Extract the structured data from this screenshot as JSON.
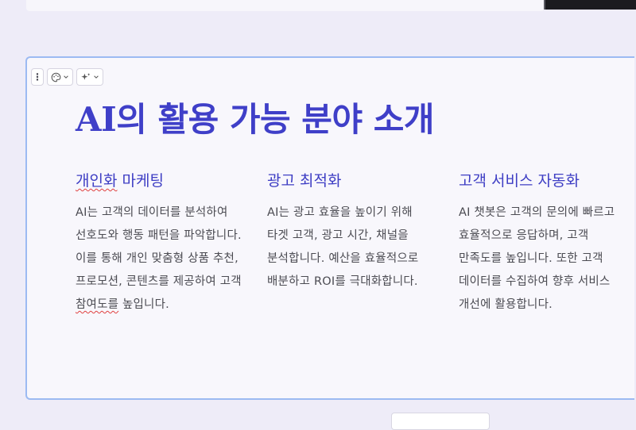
{
  "slide": {
    "title": "AI의 활용 가능 분야 소개"
  },
  "columns": [
    {
      "heading": "개인화 마케팅",
      "heading_misspelled": "개인화",
      "heading_rest": " 마케팅",
      "body_before": "AI는 고객의 데이터를 분석하여 선호도와 행동 패턴을 파악합니다. 이를 통해 개인 맞춤형 상품 추천, 프로모션, 콘텐츠를 제공하여 고객 ",
      "body_misspelled": "참여도를",
      "body_after": " 높입니다."
    },
    {
      "heading": "광고 최적화",
      "body": "AI는 광고 효율을 높이기 위해 타겟 고객, 광고 시간, 채널을 분석합니다. 예산을 효율적으로 배분하고 ROI를 극대화합니다."
    },
    {
      "heading": "고객 서비스 자동화",
      "body": "AI 챗봇은 고객의 문의에 빠르고 효율적으로 응답하며, 고객 만족도를 높입니다. 또한 고객 데이터를 수집하여 향후 서비스 개선에 활용합니다."
    }
  ],
  "toolbar": {
    "more_icon": "vertical-dots-icon",
    "theme_icon": "palette-icon",
    "ai_icon": "sparkle-icon",
    "dropdown_icon": "chevron-down-icon"
  },
  "colors": {
    "accent": "#3f3fc8",
    "body_text": "#4b4b52",
    "selection_border": "#9cbaf2",
    "background": "#eeecf8"
  }
}
